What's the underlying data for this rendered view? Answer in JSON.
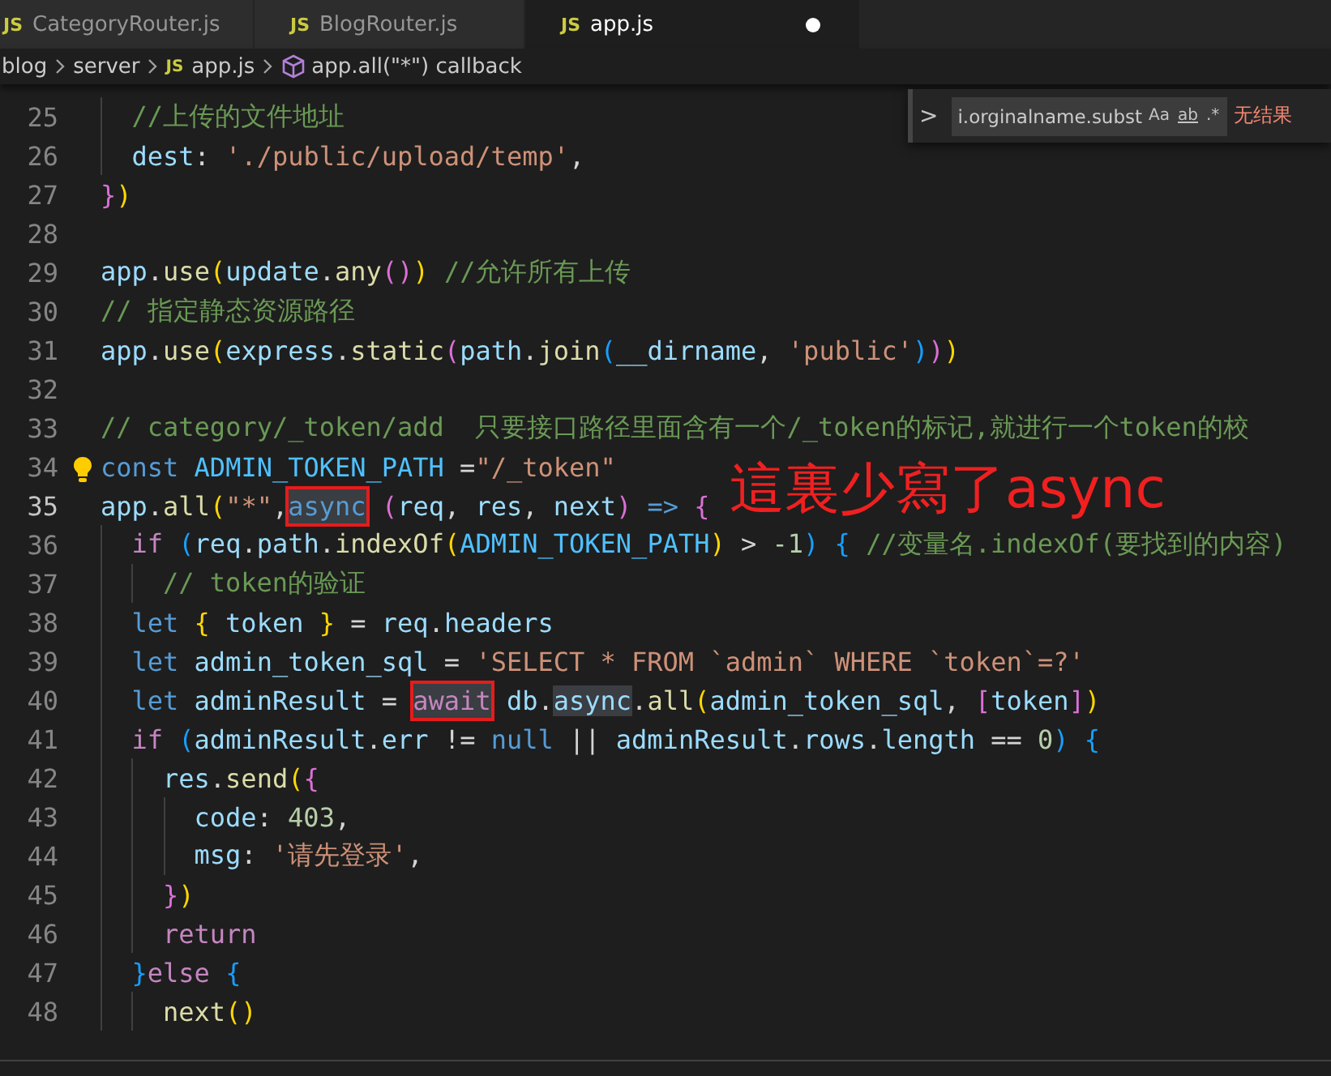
{
  "tabs": [
    {
      "icon": "JS",
      "label": "CategoryRouter.js",
      "selected": false
    },
    {
      "icon": "JS",
      "label": "BlogRouter.js",
      "selected": false
    },
    {
      "icon": "JS",
      "label": "app.js",
      "selected": true,
      "modified": true
    }
  ],
  "breadcrumb": [
    {
      "kind": "folder",
      "label": "blog"
    },
    {
      "kind": "folder",
      "label": "server"
    },
    {
      "kind": "file",
      "icon": "JS",
      "label": "app.js"
    },
    {
      "kind": "symbol",
      "label": "app.all(\"*\") callback"
    }
  ],
  "find_widget": {
    "toggle": ">",
    "value": "i.orginalname.subst",
    "options": [
      "Aa",
      "ab",
      ".*"
    ],
    "result": "无结果"
  },
  "annotation": "這裏少寫了async",
  "lines": [
    {
      "children": [
        {
          "number": "25",
          "current": false,
          "tokens": [
            {
              "kind": "cmt",
              "text": "//上传的文件地址"
            }
          ]
        },
        {
          "number": "26",
          "current": false,
          "tokens": [
            {
              "kind": "var",
              "text": "dest"
            },
            {
              "kind": "p",
              "text": ": "
            },
            {
              "kind": "str",
              "text": "'./public/upload/temp'"
            },
            {
              "kind": "p",
              "text": ","
            }
          ]
        }
      ]
    },
    {
      "number": "27",
      "current": false,
      "tokens": [
        {
          "kind": "b2",
          "text": "}"
        },
        {
          "kind": "b1",
          "text": ")"
        }
      ]
    },
    {
      "number": "28",
      "current": false
    },
    {
      "number": "29",
      "current": false,
      "tokens": [
        {
          "kind": "var",
          "text": "app"
        },
        {
          "kind": "p",
          "text": "."
        },
        {
          "kind": "fn",
          "text": "use"
        },
        {
          "kind": "b1",
          "text": "("
        },
        {
          "kind": "var",
          "text": "update"
        },
        {
          "kind": "p",
          "text": "."
        },
        {
          "kind": "fn",
          "text": "any"
        },
        {
          "kind": "b2",
          "text": "()"
        },
        {
          "kind": "b1",
          "text": ") "
        },
        {
          "kind": "cmt",
          "text": "//允许所有上传"
        }
      ]
    },
    {
      "number": "30",
      "current": false,
      "tokens": [
        {
          "kind": "cmt",
          "text": "// 指定静态资源路径"
        }
      ]
    },
    {
      "number": "31",
      "current": false,
      "tokens": [
        {
          "kind": "var",
          "text": "app"
        },
        {
          "kind": "p",
          "text": "."
        },
        {
          "kind": "fn",
          "text": "use"
        },
        {
          "kind": "b1",
          "text": "("
        },
        {
          "kind": "var",
          "text": "express"
        },
        {
          "kind": "p",
          "text": "."
        },
        {
          "kind": "fn",
          "text": "static"
        },
        {
          "kind": "b2",
          "text": "("
        },
        {
          "kind": "var",
          "text": "path"
        },
        {
          "kind": "p",
          "text": "."
        },
        {
          "kind": "fn",
          "text": "join"
        },
        {
          "kind": "b3",
          "text": "("
        },
        {
          "kind": "var",
          "text": "__dirname"
        },
        {
          "kind": "p",
          "text": ", "
        },
        {
          "kind": "str",
          "text": "'public'"
        },
        {
          "kind": "b3",
          "text": ")"
        },
        {
          "kind": "b2",
          "text": ")"
        },
        {
          "kind": "b1",
          "text": ")"
        }
      ]
    },
    {
      "number": "32",
      "current": false
    },
    {
      "number": "33",
      "current": false,
      "tokens": [
        {
          "kind": "cmt",
          "text": "// category/_token/add  只要接口路径里面含有一个/_token的标记,就进行一个token的校"
        }
      ]
    },
    {
      "number": "34",
      "current": false,
      "tokens": [
        {
          "kind": "kw",
          "text": "const "
        },
        {
          "kind": "const",
          "text": "ADMIN_TOKEN_PATH"
        },
        {
          "kind": "p",
          "text": " ="
        },
        {
          "kind": "str",
          "text": "\"/_token\""
        }
      ]
    },
    {
      "number": "35",
      "current": true,
      "tokens": [
        {
          "kind": "var",
          "text": "app"
        },
        {
          "kind": "p",
          "text": "."
        },
        {
          "kind": "fn",
          "text": "all"
        },
        {
          "kind": "b1",
          "text": "("
        },
        {
          "kind": "str",
          "text": "\"*\""
        },
        {
          "kind": "p",
          "text": ","
        },
        {
          "kind": "kw",
          "text": "async",
          "highlighted": true,
          "boxed": true
        },
        {
          "kind": "b2",
          "text": " ("
        },
        {
          "kind": "var",
          "text": "req"
        },
        {
          "kind": "p",
          "text": ", "
        },
        {
          "kind": "var",
          "text": "res"
        },
        {
          "kind": "p",
          "text": ", "
        },
        {
          "kind": "var",
          "text": "next"
        },
        {
          "kind": "b2",
          "text": ") "
        },
        {
          "kind": "kw",
          "text": "=> "
        },
        {
          "kind": "b2",
          "text": "{"
        }
      ],
      "children": [
        {
          "number": "36",
          "current": false,
          "tokens": [
            {
              "kind": "ctl",
              "text": "if "
            },
            {
              "kind": "b3",
              "text": "("
            },
            {
              "kind": "var",
              "text": "req"
            },
            {
              "kind": "p",
              "text": "."
            },
            {
              "kind": "var",
              "text": "path"
            },
            {
              "kind": "p",
              "text": "."
            },
            {
              "kind": "fn",
              "text": "indexOf"
            },
            {
              "kind": "b1",
              "text": "("
            },
            {
              "kind": "const",
              "text": "ADMIN_TOKEN_PATH"
            },
            {
              "kind": "b1",
              "text": ")"
            },
            {
              "kind": "p",
              "text": " > "
            },
            {
              "kind": "num",
              "text": "-1"
            },
            {
              "kind": "b3",
              "text": ") "
            },
            {
              "kind": "b3",
              "text": "{ "
            },
            {
              "kind": "cmt",
              "text": "//变量名.indexOf(要找到的内容)"
            }
          ],
          "children": [
            {
              "number": "37",
              "current": false,
              "tokens": [
                {
                  "kind": "cmt",
                  "text": "// token的验证"
                }
              ]
            }
          ]
        },
        {
          "number": "38",
          "current": false,
          "tokens": [
            {
              "kind": "kw",
              "text": "let "
            },
            {
              "kind": "b1",
              "text": "{ "
            },
            {
              "kind": "var",
              "text": "token "
            },
            {
              "kind": "b1",
              "text": "}"
            },
            {
              "kind": "p",
              "text": " = "
            },
            {
              "kind": "var",
              "text": "req"
            },
            {
              "kind": "p",
              "text": "."
            },
            {
              "kind": "var",
              "text": "headers"
            }
          ]
        },
        {
          "number": "39",
          "current": false,
          "tokens": [
            {
              "kind": "kw",
              "text": "let "
            },
            {
              "kind": "var",
              "text": "admin_token_sql"
            },
            {
              "kind": "p",
              "text": " = "
            },
            {
              "kind": "str",
              "text": "'SELECT * FROM `admin` WHERE `token`=?'"
            }
          ]
        },
        {
          "number": "40",
          "current": false,
          "tokens": [
            {
              "kind": "kw",
              "text": "let "
            },
            {
              "kind": "var",
              "text": "adminResult"
            },
            {
              "kind": "p",
              "text": " = "
            },
            {
              "kind": "ctl",
              "text": "await",
              "highlighted": true,
              "boxed": true
            },
            {
              "kind": "var",
              "text": " db"
            },
            {
              "kind": "p",
              "text": "."
            },
            {
              "kind": "var",
              "text": "async",
              "highlighted": true
            },
            {
              "kind": "p",
              "text": "."
            },
            {
              "kind": "fn",
              "text": "all"
            },
            {
              "kind": "b1",
              "text": "("
            },
            {
              "kind": "var",
              "text": "admin_token_sql"
            },
            {
              "kind": "p",
              "text": ", "
            },
            {
              "kind": "b2",
              "text": "["
            },
            {
              "kind": "var",
              "text": "token"
            },
            {
              "kind": "b2",
              "text": "]"
            },
            {
              "kind": "b1",
              "text": ")"
            }
          ]
        },
        {
          "number": "41",
          "current": false,
          "tokens": [
            {
              "kind": "ctl",
              "text": "if "
            },
            {
              "kind": "b3",
              "text": "("
            },
            {
              "kind": "var",
              "text": "adminResult"
            },
            {
              "kind": "p",
              "text": "."
            },
            {
              "kind": "var",
              "text": "err"
            },
            {
              "kind": "p",
              "text": " != "
            },
            {
              "kind": "kw",
              "text": "null"
            },
            {
              "kind": "p",
              "text": " || "
            },
            {
              "kind": "var",
              "text": "adminResult"
            },
            {
              "kind": "p",
              "text": "."
            },
            {
              "kind": "var",
              "text": "rows"
            },
            {
              "kind": "p",
              "text": "."
            },
            {
              "kind": "var",
              "text": "length"
            },
            {
              "kind": "p",
              "text": " == "
            },
            {
              "kind": "num",
              "text": "0"
            },
            {
              "kind": "b3",
              "text": ") "
            },
            {
              "kind": "b3",
              "text": "{"
            }
          ],
          "children": [
            {
              "number": "42",
              "current": false,
              "tokens": [
                {
                  "kind": "var",
                  "text": "res"
                },
                {
                  "kind": "p",
                  "text": "."
                },
                {
                  "kind": "fn",
                  "text": "send"
                },
                {
                  "kind": "b1",
                  "text": "("
                },
                {
                  "kind": "b2",
                  "text": "{"
                }
              ],
              "children": [
                {
                  "number": "43",
                  "current": false,
                  "tokens": [
                    {
                      "kind": "var",
                      "text": "code"
                    },
                    {
                      "kind": "p",
                      "text": ": "
                    },
                    {
                      "kind": "num",
                      "text": "403"
                    },
                    {
                      "kind": "p",
                      "text": ","
                    }
                  ]
                },
                {
                  "number": "44",
                  "current": false,
                  "tokens": [
                    {
                      "kind": "var",
                      "text": "msg"
                    },
                    {
                      "kind": "p",
                      "text": ": "
                    },
                    {
                      "kind": "str",
                      "text": "'请先登录'"
                    },
                    {
                      "kind": "p",
                      "text": ","
                    }
                  ]
                }
              ]
            },
            {
              "number": "45",
              "current": false,
              "tokens": [
                {
                  "kind": "b2",
                  "text": "}"
                },
                {
                  "kind": "b1",
                  "text": ")"
                }
              ]
            },
            {
              "number": "46",
              "current": false,
              "tokens": [
                {
                  "kind": "ctl",
                  "text": "return"
                }
              ]
            }
          ]
        },
        {
          "number": "47",
          "current": false,
          "tokens": [
            {
              "kind": "b3",
              "text": "}"
            },
            {
              "kind": "ctl",
              "text": "else "
            },
            {
              "kind": "b3",
              "text": "{"
            }
          ],
          "children": [
            {
              "number": "48",
              "current": false,
              "tokens": [
                {
                  "kind": "fn",
                  "text": "next"
                },
                {
                  "kind": "b1",
                  "text": "()"
                }
              ]
            }
          ]
        }
      ]
    }
  ]
}
